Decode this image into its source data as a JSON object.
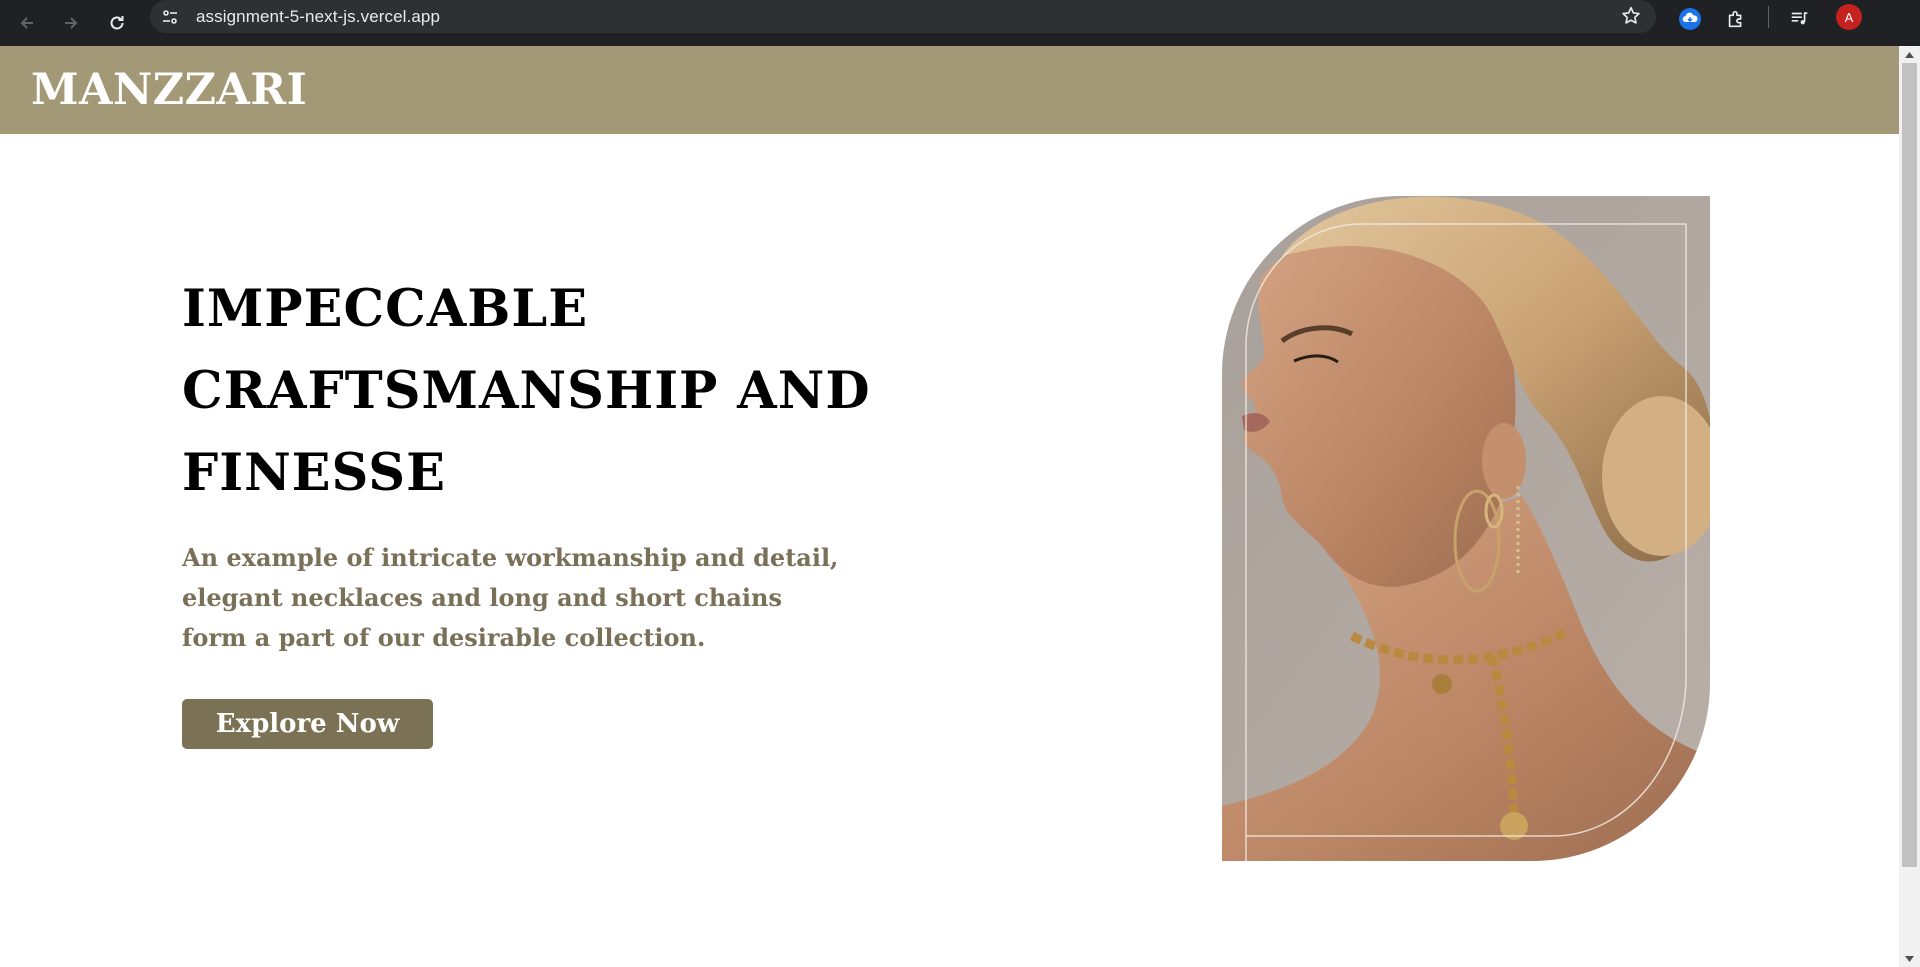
{
  "browser": {
    "url": "assignment-5-next-js.vercel.app",
    "profile_initial": "A",
    "icons": [
      "back-icon",
      "forward-icon",
      "reload-icon",
      "site-info-icon",
      "bookmark-star-icon",
      "cloud-extension-icon",
      "puzzle-extensions-icon",
      "media-queue-icon"
    ]
  },
  "site": {
    "logo": "MANZZARI",
    "hero": {
      "title": "IMPECCABLE CRAFTSMANSHIP AND FINESSE",
      "description": "An example of intricate workmanship and detail, elegant necklaces and long and short chains form a part of our desirable collection.",
      "cta_label": "Explore Now"
    }
  },
  "colors": {
    "header_bg": "#a39977",
    "cta_bg": "#7b7256",
    "description_text": "#7a6f57",
    "title_text": "#000000",
    "chrome_bg": "#202124"
  }
}
